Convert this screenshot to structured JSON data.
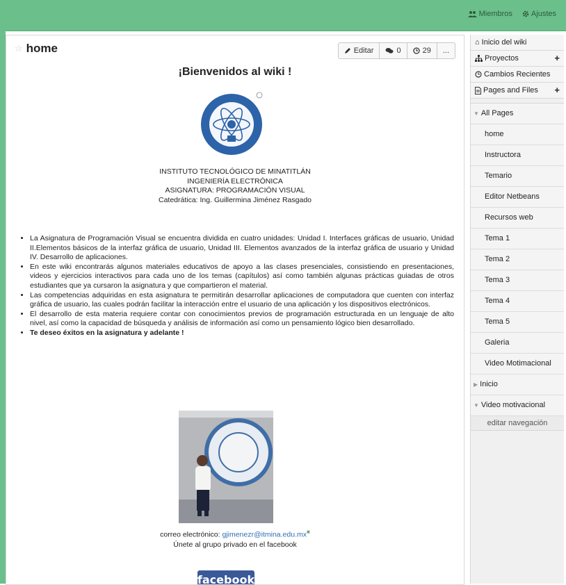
{
  "topbar": {
    "members_label": "Miembros",
    "settings_label": "Ajustes"
  },
  "page": {
    "title": "home",
    "actions": {
      "edit_label": "Editar",
      "comments_count": "0",
      "history_count": "29",
      "more_label": "..."
    }
  },
  "content": {
    "welcome": "¡Bienvenidos al wiki !",
    "institute_lines": [
      "INSTITUTO TECNOLÓGICO DE MINATITLÁN",
      "INGENIERÍA ELECTRÓNICA",
      "ASIGNATURA: PROGRAMACIÓN VISUAL",
      "Catedrática: Ing. Guillermina Jiménez Rasgado"
    ],
    "bullets": [
      "La Asignatura de Programación Visual se encuentra dividida en cuatro unidades: Unidad I. Interfaces gráficas de usuario, Unidad II.Elementos básicos de la interfaz gráfica de usuario, Unidad III. Elementos avanzados de la interfaz gráfica de usuario y Unidad IV. Desarrollo de aplicaciones.",
      "En este wiki encontrarás algunos materiales educativos de apoyo a las clases presenciales, consistiendo en presentaciones, videos y ejercicios interactivos para cada uno de los temas (capítulos) así como también algunas prácticas guiadas de otros estudiantes que ya cursaron la asignatura y que compartieron el material.",
      "Las competencias adquiridas en esta asignatura te permitirán desarrollar aplicaciones de computadora que cuenten con interfaz gráfica de usuario, las cuales podrán facilitar la interacción entre el usuario de una aplicación y los dispositivos electrónicos.",
      "El desarrollo de esta materia requiere contar con conocimientos previos de programación estructurada en un lenguaje de alto nivel, así como la capacidad de búsqueda y análisis de información así como un pensamiento lógico bien desarrollado.",
      "Te deseo éxitos en la asignatura y adelante !"
    ],
    "email_label": "correo electrónico: ",
    "email": "gjimenezr@itmina.edu.mx",
    "group_text": "Únete al grupo privado en el facebook",
    "facebook_label": "facebook"
  },
  "sidebar": {
    "top_items": [
      {
        "label": "Inicio del wiki",
        "icon": "home-icon"
      },
      {
        "label": "Proyectos",
        "icon": "sitemap-icon",
        "plus": "+"
      },
      {
        "label": "Cambios Recientes",
        "icon": "clock-icon"
      },
      {
        "label": "Pages and Files",
        "icon": "file-icon",
        "plus": "+"
      }
    ],
    "nav": {
      "all_pages": "All Pages",
      "pages": [
        "home",
        "Instructora",
        "Temario",
        "Editor Netbeans",
        "Recursos web",
        "Tema 1",
        "Tema 2",
        "Tema 3",
        "Tema 4",
        "Tema 5",
        "Galeria",
        "Video Motimacional"
      ],
      "inicio": "Inicio",
      "video_group": "Video motivacional",
      "edit_nav": "editar navegación"
    }
  },
  "colors": {
    "topbar": "#6bbf8a",
    "link": "#2f6fb5",
    "facebook": "#3b5998"
  }
}
